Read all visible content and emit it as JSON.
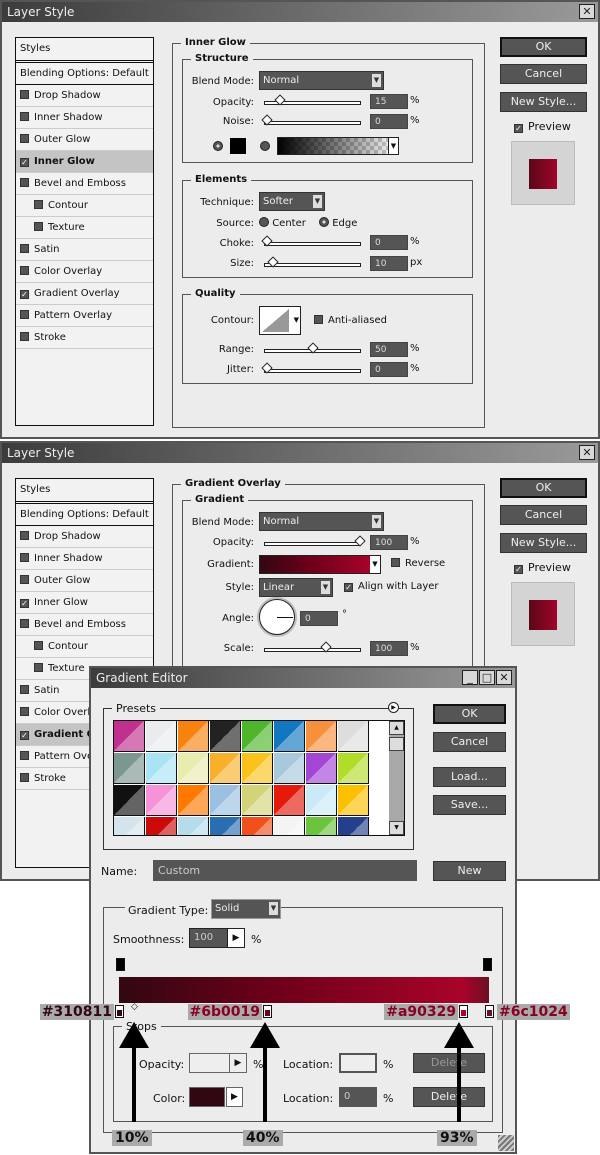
{
  "dialog1": {
    "title": "Layer Style",
    "section": "Inner Glow",
    "styles_header": "Styles",
    "blending": "Blending Options: Default",
    "items": [
      {
        "label": "Drop Shadow",
        "checked": false
      },
      {
        "label": "Inner Shadow",
        "checked": false
      },
      {
        "label": "Outer Glow",
        "checked": false
      },
      {
        "label": "Inner Glow",
        "checked": true,
        "selected": true
      },
      {
        "label": "Bevel and Emboss",
        "checked": false
      },
      {
        "label": "Contour",
        "checked": false,
        "indent": true
      },
      {
        "label": "Texture",
        "checked": false,
        "indent": true
      },
      {
        "label": "Satin",
        "checked": false
      },
      {
        "label": "Color Overlay",
        "checked": false
      },
      {
        "label": "Gradient Overlay",
        "checked": true
      },
      {
        "label": "Pattern Overlay",
        "checked": false
      },
      {
        "label": "Stroke",
        "checked": false
      }
    ],
    "structure": {
      "title": "Structure",
      "blend_label": "Blend Mode:",
      "blend": "Normal",
      "opacity_label": "Opacity:",
      "opacity": "15",
      "noise_label": "Noise:",
      "noise": "0",
      "pct": "%"
    },
    "elements": {
      "title": "Elements",
      "technique_label": "Technique:",
      "technique": "Softer",
      "source_label": "Source:",
      "center": "Center",
      "edge": "Edge",
      "choke_label": "Choke:",
      "choke": "0",
      "size_label": "Size:",
      "size": "10",
      "px": "px",
      "pct": "%"
    },
    "quality": {
      "title": "Quality",
      "contour_label": "Contour:",
      "antialiased": "Anti-aliased",
      "range_label": "Range:",
      "range": "50",
      "jitter_label": "Jitter:",
      "jitter": "0",
      "pct": "%"
    },
    "buttons": {
      "ok": "OK",
      "cancel": "Cancel",
      "new_style": "New Style...",
      "preview": "Preview"
    }
  },
  "dialog2": {
    "title": "Layer Style",
    "section": "Gradient Overlay",
    "styles_header": "Styles",
    "blending": "Blending Options: Default",
    "items": [
      {
        "label": "Drop Shadow"
      },
      {
        "label": "Inner Shadow"
      },
      {
        "label": "Outer Glow"
      },
      {
        "label": "Inner Glow"
      },
      {
        "label": "Bevel and Emboss"
      },
      {
        "label": "Contour"
      },
      {
        "label": "Texture"
      },
      {
        "label": "Satin"
      },
      {
        "label": "Color Overl"
      },
      {
        "label": "Gradient O"
      },
      {
        "label": "Pattern Ove"
      },
      {
        "label": "Stroke"
      }
    ],
    "gradient": {
      "title": "Gradient",
      "blend_label": "Blend Mode:",
      "blend": "Normal",
      "opacity_label": "Opacity:",
      "opacity": "100",
      "pct": "%",
      "gradient_label": "Gradient:",
      "reverse": "Reverse",
      "style_label": "Style:",
      "style": "Linear",
      "align": "Align with Layer",
      "angle_label": "Angle:",
      "angle": "0",
      "deg": "°",
      "scale_label": "Scale:",
      "scale": "100"
    },
    "buttons": {
      "ok": "OK",
      "cancel": "Cancel",
      "new_style": "New Style...",
      "preview": "Preview"
    }
  },
  "gradient_editor": {
    "title": "Gradient Editor",
    "presets": "Presets",
    "ok": "OK",
    "cancel": "Cancel",
    "load": "Load...",
    "save": "Save...",
    "name_label": "Name:",
    "name": "Custom",
    "new": "New",
    "type_label": "Gradient Type:",
    "type": "Solid",
    "smooth_label": "Smoothness:",
    "smooth": "100",
    "pct": "%",
    "stops_title": "Stops",
    "opacity_label": "Opacity:",
    "location_label": "Location:",
    "color_label": "Color:",
    "location_value": "0",
    "delete": "Delete",
    "color_stops": [
      {
        "hex": "#310811",
        "pos": 0
      },
      {
        "hex": "#6b0019",
        "pos": 40
      },
      {
        "hex": "#a90329",
        "pos": 93
      },
      {
        "hex": "#6c1024",
        "pos": 100
      }
    ],
    "annotations": [
      "10%",
      "40%",
      "93%"
    ]
  },
  "colors": {
    "preview_red": "#9a0a2a",
    "title_dark": "#3c3c3c"
  }
}
